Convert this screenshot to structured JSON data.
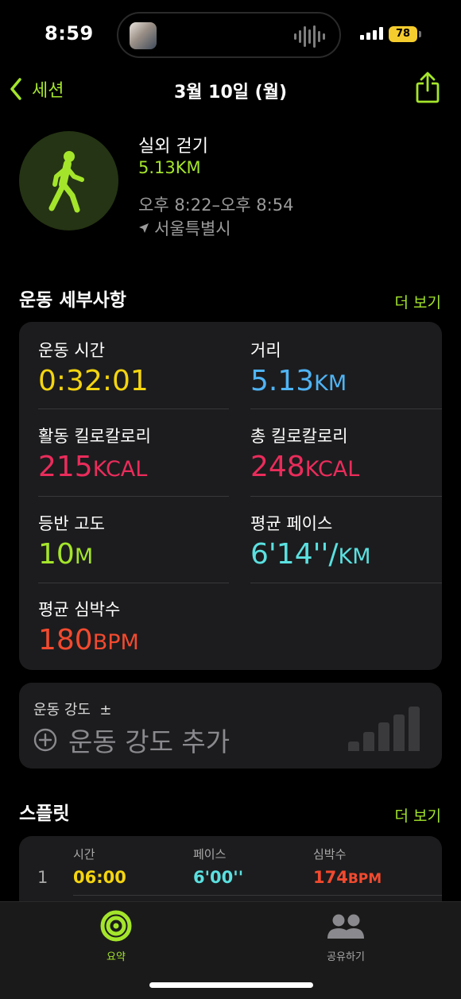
{
  "status_bar": {
    "time": "8:59",
    "battery": "78"
  },
  "nav": {
    "back_label": "세션",
    "title": "3월 10일 (월)"
  },
  "workout": {
    "name": "실외 걷기",
    "distance": "5.13KM",
    "time_range": "오후 8:22–오후 8:54",
    "location": "서울특별시"
  },
  "details": {
    "title": "운동 세부사항",
    "more": "더 보기",
    "stats": [
      {
        "label": "운동 시간",
        "value": "0:32:01",
        "unit": "",
        "color": "#f5d50f"
      },
      {
        "label": "거리",
        "value": "5.13",
        "unit": "KM",
        "color": "#4fb4f5"
      },
      {
        "label": "활동 킬로칼로리",
        "value": "215",
        "unit": "KCAL",
        "color": "#ea2c5b"
      },
      {
        "label": "총 킬로칼로리",
        "value": "248",
        "unit": "KCAL",
        "color": "#ea2c5b"
      },
      {
        "label": "등반 고도",
        "value": "10",
        "unit": "M",
        "color": "#a4e52b"
      },
      {
        "label": "평균 페이스",
        "value": "6'14''/",
        "unit": "KM",
        "color": "#5be0e0"
      },
      {
        "label": "평균 심박수",
        "value": "180",
        "unit": "BPM",
        "color": "#f24a2f"
      }
    ]
  },
  "intensity": {
    "label": "운동 강도",
    "plus_minus": "±",
    "add_label": "운동 강도 추가"
  },
  "splits": {
    "title": "스플릿",
    "more": "더 보기",
    "headers": {
      "time": "시간",
      "pace": "페이스",
      "heart_rate": "심박수"
    },
    "rows": [
      {
        "index": "1",
        "time": "06:00",
        "pace": "6'00''",
        "hr_value": "174",
        "hr_unit": "BPM"
      }
    ]
  },
  "tabbar": {
    "tabs": [
      {
        "label": "요약",
        "active": true
      },
      {
        "label": "공유하기",
        "active": false
      }
    ]
  },
  "colors": {
    "accent": "#a4e52b",
    "card": "#1c1c1e"
  }
}
